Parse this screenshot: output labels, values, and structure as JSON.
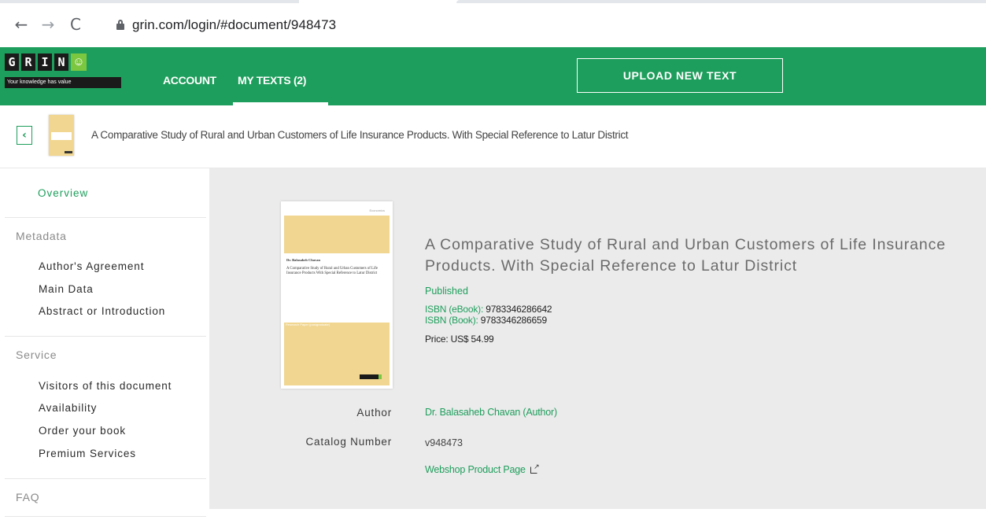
{
  "browser": {
    "url": "grin.com/login/#document/948473",
    "back_icon": "←",
    "forward_icon": "→",
    "reload_icon": "C"
  },
  "header": {
    "logo_letters": [
      "G",
      "R",
      "I",
      "N"
    ],
    "logo_smile": "☺",
    "logo_tagline": "Your knowledge has value",
    "nav_account": "ACCOUNT",
    "nav_my_texts": "MY TEXTS (2)",
    "upload_button": "UPLOAD NEW TEXT",
    "colors": {
      "brand_green": "#1e9e5c",
      "logo_green": "#7bc740"
    }
  },
  "doc_bar": {
    "back_icon": "‹",
    "title": "A Comparative Study of Rural and Urban Customers of Life Insurance Products. With Special Reference to Latur District"
  },
  "sidebar": {
    "overview": "Overview",
    "metadata_heading": "Metadata",
    "metadata_items": [
      "Author's Agreement",
      "Main Data",
      "Abstract or Introduction"
    ],
    "service_heading": "Service",
    "service_items": [
      "Visitors of this document",
      "Availability",
      "Order your book",
      "Premium Services"
    ],
    "faq_heading": "FAQ"
  },
  "document": {
    "cover": {
      "top_text": "Economics",
      "author": "Dr. Balasaheb Chavan",
      "title": "A Comparative Study of Rural and Urban Customers of Life Insurance Products With Special Reference to Latur District",
      "publisher": "Research Paper (postgraduate)"
    },
    "title": "A Comparative Study of Rural and Urban Customers of Life Insurance Products. With Special Reference to Latur District",
    "status": "Published",
    "isbn_ebook_label": "ISBN (eBook):",
    "isbn_ebook": "9783346286642",
    "isbn_book_label": "ISBN (Book):",
    "isbn_book": "9783346286659",
    "price": "Price: US$ 54.99",
    "author_label": "Author",
    "author_value": "Dr. Balasaheb Chavan (Author)",
    "catalog_label": "Catalog Number",
    "catalog_value": "v948473",
    "webshop_link": "Webshop Product Page",
    "webshop_icon": "external-link-icon"
  }
}
